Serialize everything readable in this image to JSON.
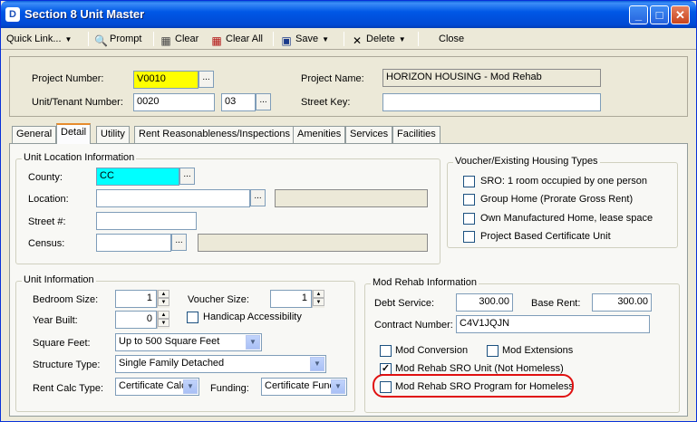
{
  "window": {
    "title": "Section 8 Unit Master",
    "icon_glyph": "D"
  },
  "toolbar": {
    "quick_link": "Quick Link...",
    "prompt": "Prompt",
    "clear": "Clear",
    "clear_all": "Clear All",
    "save": "Save",
    "delete": "Delete",
    "close": "Close"
  },
  "header": {
    "project_number_label": "Project Number:",
    "project_number": "V0010",
    "project_name_label": "Project Name:",
    "project_name": "HORIZON HOUSING - Mod Rehab",
    "unit_tenant_label": "Unit/Tenant Number:",
    "unit_number": "0020",
    "tenant_number": "03",
    "street_key_label": "Street Key:",
    "street_key": "",
    "highlight_color": "#ffff00"
  },
  "tabs": [
    "General",
    "Detail",
    "Utility",
    "Rent Reasonableness/Inspections",
    "Amenities",
    "Services",
    "Facilities"
  ],
  "active_tab": "Detail",
  "unit_location": {
    "title": "Unit Location Information",
    "county_label": "County:",
    "county": "CC",
    "county_color": "#00ffff",
    "location_label": "Location:",
    "location": "",
    "street_label": "Street #:",
    "street": "",
    "census_label": "Census:",
    "census": ""
  },
  "voucher_types": {
    "title": "Voucher/Existing Housing Types",
    "items": [
      {
        "label": "SRO: 1 room occupied by one person",
        "checked": false
      },
      {
        "label": "Group Home (Prorate Gross Rent)",
        "checked": false
      },
      {
        "label": "Own Manufactured Home, lease space",
        "checked": false
      },
      {
        "label": "Project Based Certificate Unit",
        "checked": false
      }
    ]
  },
  "unit_info": {
    "title": "Unit Information",
    "bedroom_label": "Bedroom Size:",
    "bedroom": "1",
    "voucher_label": "Voucher Size:",
    "voucher": "1",
    "year_label": "Year Built:",
    "year": "0",
    "handicap_label": "Handicap Accessibility",
    "sqft_label": "Square Feet:",
    "sqft": "Up to 500 Square Feet",
    "structure_label": "Structure Type:",
    "structure": "Single Family Detached",
    "rent_calc_label": "Rent Calc Type:",
    "rent_calc": "Certificate Calc",
    "funding_label": "Funding:",
    "funding": "Certificate Func"
  },
  "mod_rehab": {
    "title": "Mod Rehab Information",
    "debt_label": "Debt Service:",
    "debt": "300.00",
    "base_rent_label": "Base Rent:",
    "base_rent": "300.00",
    "contract_label": "Contract Number:",
    "contract": "C4V1JQJN",
    "mod_conversion": "Mod Conversion",
    "mod_extensions": "Mod Extensions",
    "sro_unit": "Mod Rehab SRO Unit (Not Homeless)",
    "sro_unit_checked": true,
    "sro_program": "Mod Rehab SRO Program for Homeless",
    "sro_program_checked": false,
    "highlight_color": "#e01010"
  }
}
